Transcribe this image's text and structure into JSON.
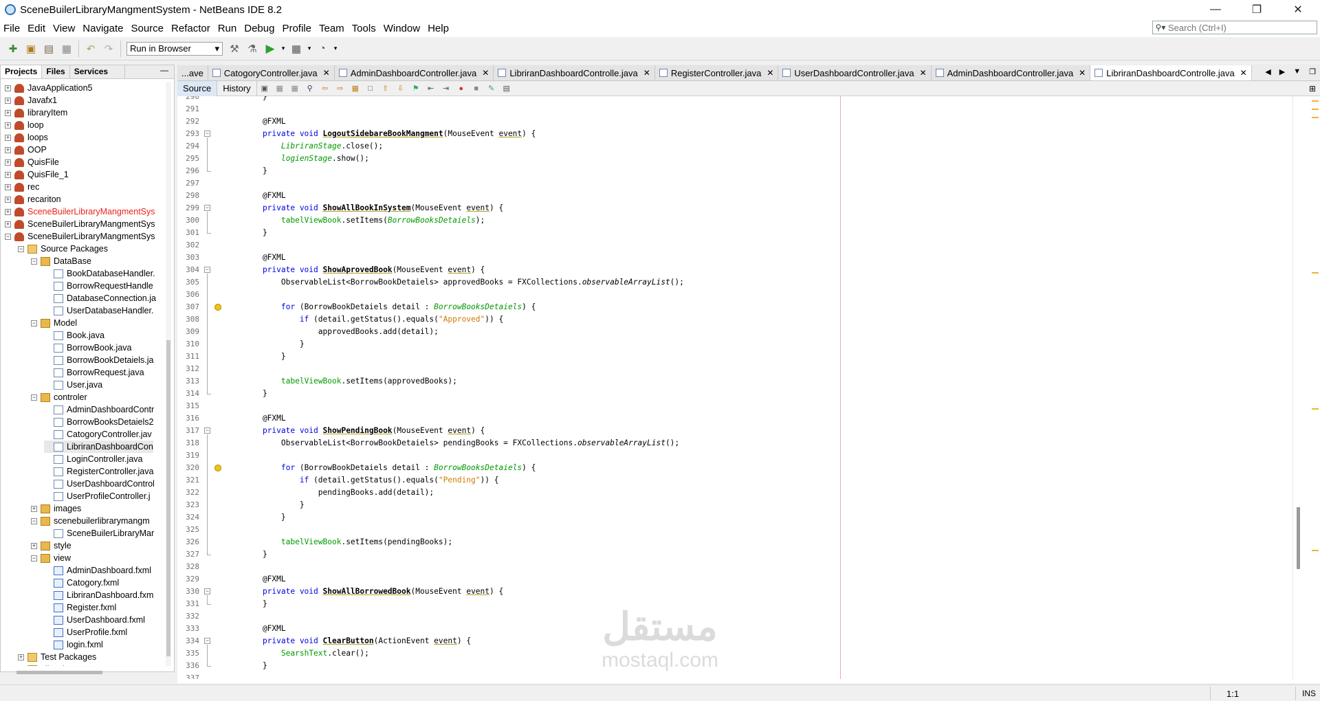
{
  "window": {
    "title": "SceneBuilerLibraryMangmentSystem - NetBeans IDE 8.2"
  },
  "menubar": [
    "File",
    "Edit",
    "View",
    "Navigate",
    "Source",
    "Refactor",
    "Run",
    "Debug",
    "Profile",
    "Team",
    "Tools",
    "Window",
    "Help"
  ],
  "search": {
    "placeholder": "Search (Ctrl+I)"
  },
  "toolbar": {
    "run_config": "Run in Browser"
  },
  "left_panel": {
    "tabs": [
      "Projects",
      "Files",
      "Services"
    ],
    "tree": [
      {
        "label": "JavaApplication5",
        "depth": 0,
        "toggle": "+",
        "icon": "project"
      },
      {
        "label": "Javafx1",
        "depth": 0,
        "toggle": "+",
        "icon": "project"
      },
      {
        "label": "libraryItem",
        "depth": 0,
        "toggle": "+",
        "icon": "project"
      },
      {
        "label": "loop",
        "depth": 0,
        "toggle": "+",
        "icon": "project"
      },
      {
        "label": "loops",
        "depth": 0,
        "toggle": "+",
        "icon": "project"
      },
      {
        "label": "OOP",
        "depth": 0,
        "toggle": "+",
        "icon": "project"
      },
      {
        "label": "QuisFile",
        "depth": 0,
        "toggle": "+",
        "icon": "project"
      },
      {
        "label": "QuisFile_1",
        "depth": 0,
        "toggle": "+",
        "icon": "project"
      },
      {
        "label": "rec",
        "depth": 0,
        "toggle": "+",
        "icon": "project"
      },
      {
        "label": "recariton",
        "depth": 0,
        "toggle": "+",
        "icon": "project"
      },
      {
        "label": "SceneBuilerLibraryMangmentSys",
        "depth": 0,
        "toggle": "+",
        "icon": "project",
        "color": "#e8231d"
      },
      {
        "label": "SceneBuilerLibraryMangmentSys",
        "depth": 0,
        "toggle": "+",
        "icon": "project"
      },
      {
        "label": "SceneBuilerLibraryMangmentSys",
        "depth": 0,
        "toggle": "-",
        "icon": "project"
      },
      {
        "label": "Source Packages",
        "depth": 1,
        "toggle": "-",
        "icon": "src"
      },
      {
        "label": "DataBase",
        "depth": 2,
        "toggle": "-",
        "icon": "pkg"
      },
      {
        "label": "BookDatabaseHandler.",
        "depth": 3,
        "toggle": "",
        "icon": "java"
      },
      {
        "label": "BorrowRequestHandle",
        "depth": 3,
        "toggle": "",
        "icon": "java"
      },
      {
        "label": "DatabaseConnection.ja",
        "depth": 3,
        "toggle": "",
        "icon": "java"
      },
      {
        "label": "UserDatabaseHandler.",
        "depth": 3,
        "toggle": "",
        "icon": "java"
      },
      {
        "label": "Model",
        "depth": 2,
        "toggle": "-",
        "icon": "pkg"
      },
      {
        "label": "Book.java",
        "depth": 3,
        "toggle": "",
        "icon": "java"
      },
      {
        "label": "BorrowBook.java",
        "depth": 3,
        "toggle": "",
        "icon": "java"
      },
      {
        "label": "BorrowBookDetaiels.ja",
        "depth": 3,
        "toggle": "",
        "icon": "java"
      },
      {
        "label": "BorrowRequest.java",
        "depth": 3,
        "toggle": "",
        "icon": "java"
      },
      {
        "label": "User.java",
        "depth": 3,
        "toggle": "",
        "icon": "java"
      },
      {
        "label": "controler",
        "depth": 2,
        "toggle": "-",
        "icon": "pkg"
      },
      {
        "label": "AdminDashboardContr",
        "depth": 3,
        "toggle": "",
        "icon": "java"
      },
      {
        "label": "BorrowBooksDetaiels2",
        "depth": 3,
        "toggle": "",
        "icon": "java"
      },
      {
        "label": "CatogoryController.jav",
        "depth": 3,
        "toggle": "",
        "icon": "java"
      },
      {
        "label": "LibriranDashboardCon",
        "depth": 3,
        "toggle": "",
        "icon": "java",
        "selected": true
      },
      {
        "label": "LoginController.java",
        "depth": 3,
        "toggle": "",
        "icon": "java"
      },
      {
        "label": "RegisterController.java",
        "depth": 3,
        "toggle": "",
        "icon": "java"
      },
      {
        "label": "UserDashboardControl",
        "depth": 3,
        "toggle": "",
        "icon": "java"
      },
      {
        "label": "UserProfileController.j",
        "depth": 3,
        "toggle": "",
        "icon": "java"
      },
      {
        "label": "images",
        "depth": 2,
        "toggle": "+",
        "icon": "pkg"
      },
      {
        "label": "scenebuilerlibrarymangm",
        "depth": 2,
        "toggle": "-",
        "icon": "pkg"
      },
      {
        "label": "SceneBuilerLibraryMar",
        "depth": 3,
        "toggle": "",
        "icon": "java"
      },
      {
        "label": "style",
        "depth": 2,
        "toggle": "+",
        "icon": "pkg"
      },
      {
        "label": "view",
        "depth": 2,
        "toggle": "-",
        "icon": "pkg"
      },
      {
        "label": "AdminDashboard.fxml",
        "depth": 3,
        "toggle": "",
        "icon": "fxml"
      },
      {
        "label": "Catogory.fxml",
        "depth": 3,
        "toggle": "",
        "icon": "fxml"
      },
      {
        "label": "LibriranDashboard.fxm",
        "depth": 3,
        "toggle": "",
        "icon": "fxml"
      },
      {
        "label": "Register.fxml",
        "depth": 3,
        "toggle": "",
        "icon": "fxml"
      },
      {
        "label": "UserDashboard.fxml",
        "depth": 3,
        "toggle": "",
        "icon": "fxml"
      },
      {
        "label": "UserProfile.fxml",
        "depth": 3,
        "toggle": "",
        "icon": "fxml"
      },
      {
        "label": "login.fxml",
        "depth": 3,
        "toggle": "",
        "icon": "fxml"
      },
      {
        "label": "Test Packages",
        "depth": 1,
        "toggle": "+",
        "icon": "src"
      },
      {
        "label": "Libraries",
        "depth": 1,
        "toggle": "+",
        "icon": "src"
      }
    ]
  },
  "editor_tabs": [
    {
      "label": "...ave",
      "active": false,
      "closable": false
    },
    {
      "label": "CatogoryController.java",
      "active": false,
      "closable": true
    },
    {
      "label": "AdminDashboardController.java",
      "active": false,
      "closable": true
    },
    {
      "label": "LibriranDashboardControlle.java",
      "active": false,
      "closable": true
    },
    {
      "label": "RegisterController.java",
      "active": false,
      "closable": true
    },
    {
      "label": "UserDashboardController.java",
      "active": false,
      "closable": true
    },
    {
      "label": "AdminDashboardController.java",
      "active": false,
      "closable": true
    },
    {
      "label": "LibriranDashboardControlle.java",
      "active": true,
      "closable": true
    }
  ],
  "source_tabs": {
    "source": "Source",
    "history": "History"
  },
  "code": {
    "first_line_number": 290,
    "lines": [
      [
        [
          "",
          "    }"
        ]
      ],
      [
        [
          "",
          ""
        ]
      ],
      [
        [
          "an",
          "    @FXML"
        ]
      ],
      [
        [
          "kw",
          "    private void "
        ],
        [
          "b u",
          "LogoutSidebareBookMangment"
        ],
        [
          "",
          "(MouseEvent "
        ],
        [
          "u",
          "event"
        ],
        [
          "",
          ") {"
        ]
      ],
      [
        [
          "",
          "        "
        ],
        [
          "fld-i",
          "LibriranStage"
        ],
        [
          "",
          ".close();"
        ]
      ],
      [
        [
          "",
          "        "
        ],
        [
          "fld-i",
          "logienStage"
        ],
        [
          "",
          ".show();"
        ]
      ],
      [
        [
          "",
          "    }"
        ]
      ],
      [
        [
          "",
          ""
        ]
      ],
      [
        [
          "an",
          "    @FXML"
        ]
      ],
      [
        [
          "kw",
          "    private void "
        ],
        [
          "b u",
          "ShowAllBookInSystem"
        ],
        [
          "",
          "(MouseEvent "
        ],
        [
          "u",
          "event"
        ],
        [
          "",
          ") {"
        ]
      ],
      [
        [
          "",
          "        "
        ],
        [
          "fld",
          "tabelViewBook"
        ],
        [
          "",
          ".setItems("
        ],
        [
          "fld-i",
          "BorrowBooksDetaiels"
        ],
        [
          "",
          ");"
        ]
      ],
      [
        [
          "",
          "    }"
        ]
      ],
      [
        [
          "",
          ""
        ]
      ],
      [
        [
          "an",
          "    @FXML"
        ]
      ],
      [
        [
          "kw",
          "    private void "
        ],
        [
          "b u",
          "ShowAprovedBook"
        ],
        [
          "",
          "(MouseEvent "
        ],
        [
          "u",
          "event"
        ],
        [
          "",
          ") {"
        ]
      ],
      [
        [
          "",
          "        ObservableList<BorrowBookDetaiels> approvedBooks = FXCollections."
        ],
        [
          "mi",
          "observableArrayList"
        ],
        [
          "",
          "();"
        ]
      ],
      [
        [
          "",
          ""
        ]
      ],
      [
        [
          "kw",
          "        for"
        ],
        [
          "",
          " (BorrowBookDetaiels detail : "
        ],
        [
          "fld-i",
          "BorrowBooksDetaiels"
        ],
        [
          "",
          ") {"
        ]
      ],
      [
        [
          "kw",
          "            if"
        ],
        [
          "",
          " (detail.getStatus().equals("
        ],
        [
          "str",
          "\"Approved\""
        ],
        [
          "",
          ")) {"
        ]
      ],
      [
        [
          "",
          "                approvedBooks.add(detail);"
        ]
      ],
      [
        [
          "",
          "            }"
        ]
      ],
      [
        [
          "",
          "        }"
        ]
      ],
      [
        [
          "",
          ""
        ]
      ],
      [
        [
          "",
          "        "
        ],
        [
          "fld",
          "tabelViewBook"
        ],
        [
          "",
          ".setItems(approvedBooks);"
        ]
      ],
      [
        [
          "",
          "    }"
        ]
      ],
      [
        [
          "",
          ""
        ]
      ],
      [
        [
          "an",
          "    @FXML"
        ]
      ],
      [
        [
          "kw",
          "    private void "
        ],
        [
          "b u",
          "ShowPendingBook"
        ],
        [
          "",
          "(MouseEvent "
        ],
        [
          "u",
          "event"
        ],
        [
          "",
          ") {"
        ]
      ],
      [
        [
          "",
          "        ObservableList<BorrowBookDetaiels> pendingBooks = FXCollections."
        ],
        [
          "mi",
          "observableArrayList"
        ],
        [
          "",
          "();"
        ]
      ],
      [
        [
          "",
          ""
        ]
      ],
      [
        [
          "kw",
          "        for"
        ],
        [
          "",
          " (BorrowBookDetaiels detail : "
        ],
        [
          "fld-i",
          "BorrowBooksDetaiels"
        ],
        [
          "",
          ") {"
        ]
      ],
      [
        [
          "kw",
          "            if"
        ],
        [
          "",
          " (detail.getStatus().equals("
        ],
        [
          "str",
          "\"Pending\""
        ],
        [
          "",
          ")) {"
        ]
      ],
      [
        [
          "",
          "                pendingBooks.add(detail);"
        ]
      ],
      [
        [
          "",
          "            }"
        ]
      ],
      [
        [
          "",
          "        }"
        ]
      ],
      [
        [
          "",
          ""
        ]
      ],
      [
        [
          "",
          "        "
        ],
        [
          "fld",
          "tabelViewBook"
        ],
        [
          "",
          ".setItems(pendingBooks);"
        ]
      ],
      [
        [
          "",
          "    }"
        ]
      ],
      [
        [
          "",
          ""
        ]
      ],
      [
        [
          "an",
          "    @FXML"
        ]
      ],
      [
        [
          "kw",
          "    private void "
        ],
        [
          "b u",
          "ShowAllBorrowedBook"
        ],
        [
          "",
          "(MouseEvent "
        ],
        [
          "u",
          "event"
        ],
        [
          "",
          ") {"
        ]
      ],
      [
        [
          "",
          "    }"
        ]
      ],
      [
        [
          "",
          ""
        ]
      ],
      [
        [
          "an",
          "    @FXML"
        ]
      ],
      [
        [
          "kw",
          "    private void "
        ],
        [
          "b u",
          "ClearButton"
        ],
        [
          "",
          "(ActionEvent "
        ],
        [
          "u",
          "event"
        ],
        [
          "",
          ") {"
        ]
      ],
      [
        [
          "",
          "        "
        ],
        [
          "fld",
          "SearshText"
        ],
        [
          "",
          ".clear();"
        ]
      ],
      [
        [
          "",
          "    }"
        ]
      ],
      [
        [
          "",
          ""
        ]
      ]
    ]
  },
  "status": {
    "position": "1:1",
    "mode": "INS"
  },
  "watermark": {
    "arabic": "مستقل",
    "latin": "mostaql.com"
  },
  "colors": {
    "keyword": "#0000e6",
    "string": "#ce7b00",
    "field": "#009900",
    "red_project": "#e8231d"
  }
}
